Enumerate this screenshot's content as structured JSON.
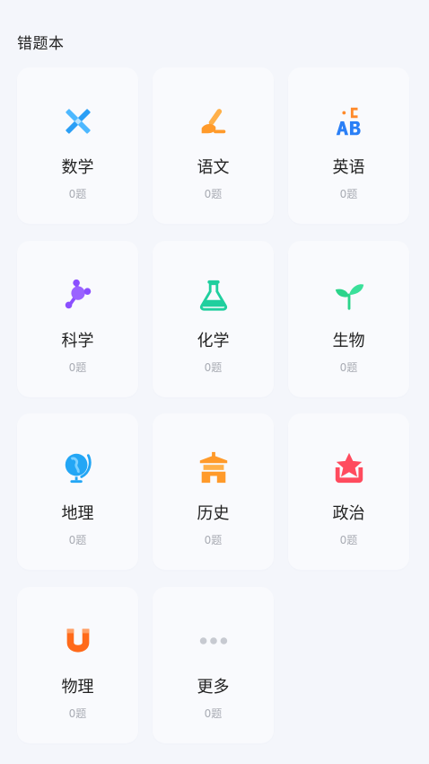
{
  "header": {
    "title": "错题本"
  },
  "subjects": [
    {
      "name": "数学",
      "count": "0题",
      "icon": "ruler-pencil-icon",
      "color": "#2a9ff6"
    },
    {
      "name": "语文",
      "count": "0题",
      "icon": "brush-icon",
      "color": "#ff9a2a"
    },
    {
      "name": "英语",
      "count": "0题",
      "icon": "abc-letters-icon",
      "color": "#2a7ff6"
    },
    {
      "name": "科学",
      "count": "0题",
      "icon": "molecule-icon",
      "color": "#8b4fff"
    },
    {
      "name": "化学",
      "count": "0题",
      "icon": "flask-icon",
      "color": "#1fcf9e"
    },
    {
      "name": "生物",
      "count": "0题",
      "icon": "sprout-icon",
      "color": "#2bd48a"
    },
    {
      "name": "地理",
      "count": "0题",
      "icon": "globe-icon",
      "color": "#23a6f5"
    },
    {
      "name": "历史",
      "count": "0题",
      "icon": "temple-icon",
      "color": "#ff9a2a"
    },
    {
      "name": "政治",
      "count": "0题",
      "icon": "star-icon",
      "color": "#ff4b5e"
    },
    {
      "name": "物理",
      "count": "0题",
      "icon": "magnet-icon",
      "color": "#ff6a1a"
    },
    {
      "name": "更多",
      "count": "0题",
      "icon": "more-dots-icon",
      "color": "#c7cad1"
    }
  ]
}
